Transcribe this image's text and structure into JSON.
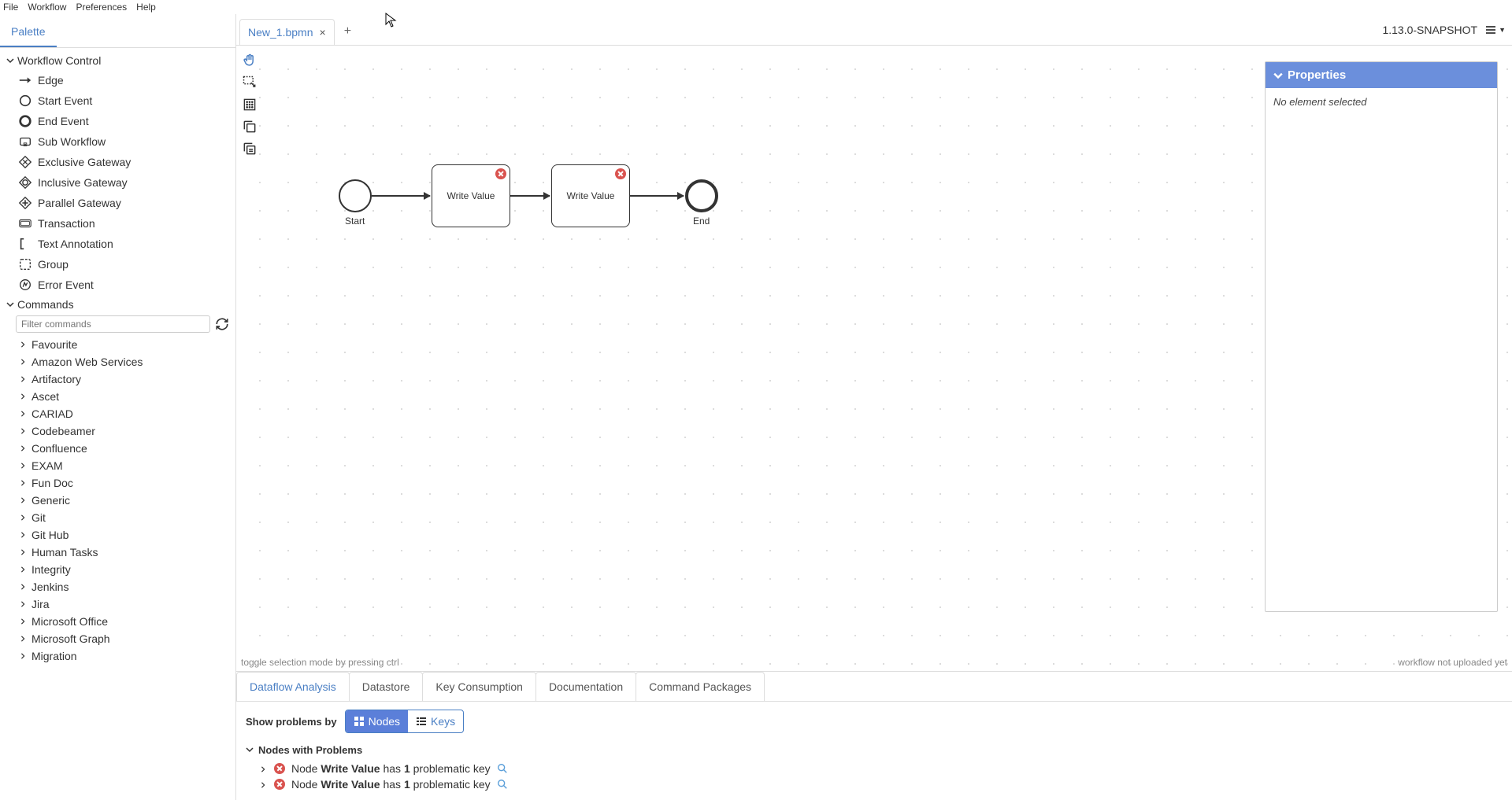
{
  "menubar": [
    "File",
    "Workflow",
    "Preferences",
    "Help"
  ],
  "palette": {
    "tab": "Palette",
    "workflow_control": {
      "title": "Workflow Control",
      "items": [
        {
          "id": "edge",
          "label": "Edge"
        },
        {
          "id": "start-event",
          "label": "Start Event"
        },
        {
          "id": "end-event",
          "label": "End Event"
        },
        {
          "id": "sub-workflow",
          "label": "Sub Workflow"
        },
        {
          "id": "exclusive-gateway",
          "label": "Exclusive Gateway"
        },
        {
          "id": "inclusive-gateway",
          "label": "Inclusive Gateway"
        },
        {
          "id": "parallel-gateway",
          "label": "Parallel Gateway"
        },
        {
          "id": "transaction",
          "label": "Transaction"
        },
        {
          "id": "text-annotation",
          "label": "Text Annotation"
        },
        {
          "id": "group",
          "label": "Group"
        },
        {
          "id": "error-event",
          "label": "Error Event"
        }
      ]
    },
    "commands": {
      "title": "Commands",
      "filter_placeholder": "Filter commands",
      "groups": [
        "Favourite",
        "Amazon Web Services",
        "Artifactory",
        "Ascet",
        "CARIAD",
        "Codebeamer",
        "Confluence",
        "EXAM",
        "Fun Doc",
        "Generic",
        "Git",
        "Git Hub",
        "Human Tasks",
        "Integrity",
        "Jenkins",
        "Jira",
        "Microsoft Office",
        "Microsoft Graph",
        "Migration"
      ]
    }
  },
  "tabs": {
    "file": "New_1.bpmn",
    "add": "+"
  },
  "version": "1.13.0-SNAPSHOT",
  "canvas": {
    "hint": "toggle selection mode by pressing ctrl",
    "upload_status": "workflow not uploaded yet",
    "nodes": {
      "start": "Start",
      "task1": "Write Value",
      "task2": "Write Value",
      "end": "End"
    }
  },
  "properties": {
    "title": "Properties",
    "body": "No element selected"
  },
  "bottom": {
    "tabs": [
      "Dataflow Analysis",
      "Datastore",
      "Key Consumption",
      "Documentation",
      "Command Packages"
    ],
    "active_tab": 0,
    "toggle_label": "Show problems by",
    "seg_nodes": "Nodes",
    "seg_keys": "Keys",
    "problems_header": "Nodes with Problems",
    "problems": [
      {
        "prefix": "Node ",
        "name": "Write Value",
        "mid": " has ",
        "count": "1",
        "suffix": " problematic key"
      },
      {
        "prefix": "Node ",
        "name": "Write Value",
        "mid": " has ",
        "count": "1",
        "suffix": " problematic key"
      }
    ]
  },
  "chart_data": {
    "type": "diagram",
    "title": "BPMN Workflow",
    "nodes": [
      {
        "id": "start",
        "type": "start-event",
        "label": "Start"
      },
      {
        "id": "t1",
        "type": "task",
        "label": "Write Value",
        "error": true
      },
      {
        "id": "t2",
        "type": "task",
        "label": "Write Value",
        "error": true
      },
      {
        "id": "end",
        "type": "end-event",
        "label": "End"
      }
    ],
    "edges": [
      {
        "from": "start",
        "to": "t1"
      },
      {
        "from": "t1",
        "to": "t2"
      },
      {
        "from": "t2",
        "to": "end"
      }
    ]
  }
}
